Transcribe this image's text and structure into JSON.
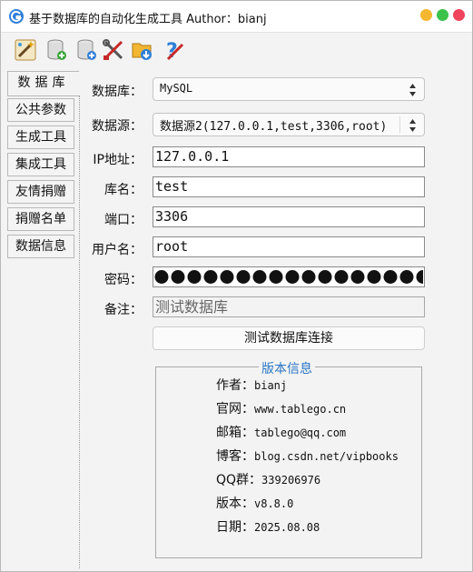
{
  "window": {
    "title": "基于数据库的自动化生成工具  Author：bianj",
    "accent": "#2a76c6"
  },
  "toolbar": {
    "icons": [
      "wand-icon",
      "db-add-icon",
      "db-connect-icon",
      "tools-icon",
      "folder-download-icon",
      "help-icon"
    ]
  },
  "tabs": [
    {
      "label": "数据库",
      "active": true
    },
    {
      "label": "公共参数"
    },
    {
      "label": "生成工具"
    },
    {
      "label": "集成工具"
    },
    {
      "label": "友情捐赠"
    },
    {
      "label": "捐赠名单"
    },
    {
      "label": "数据信息"
    }
  ],
  "form": {
    "db_type_label": "数据库：",
    "db_type_value": "MySQL",
    "source_label": "数据源：",
    "source_value": "数据源2(127.0.0.1,test,3306,root)",
    "ip_label": "IP地址：",
    "ip_value": "127.0.0.1",
    "dbname_label": "库名：",
    "dbname_value": "test",
    "port_label": "端口：",
    "port_value": "3306",
    "user_label": "用户名：",
    "user_value": "root",
    "password_label": "密码：",
    "note_label": "备注：",
    "note_value": "测试数据库",
    "test_button": "测试数据库连接"
  },
  "version": {
    "legend": "版本信息",
    "author_label": "作者：",
    "author": "bianj",
    "site_label": "官网：",
    "site": "www.tablego.cn",
    "email_label": "邮箱：",
    "email": "tablego@qq.com",
    "blog_label": "博客：",
    "blog": "blog.csdn.net/vipbooks",
    "qq_label": "QQ群：",
    "qq": "339206976",
    "ver_label": "版本：",
    "ver": "v8.8.0",
    "date_label": "日期：",
    "date": "2025.08.08"
  }
}
